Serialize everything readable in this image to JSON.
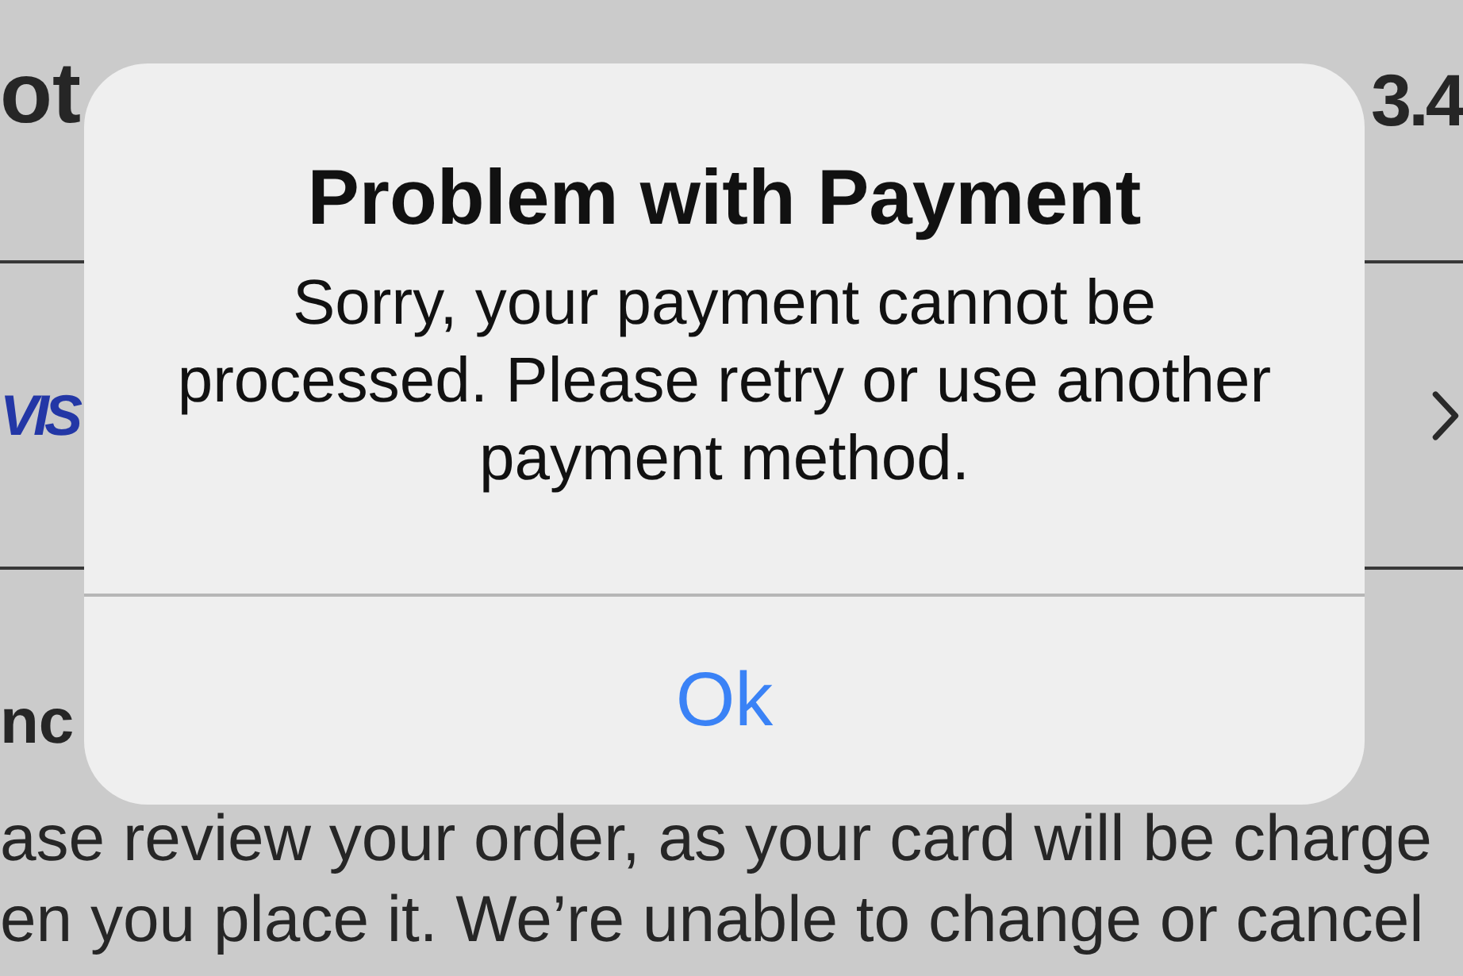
{
  "background_page": {
    "total_label": "ot",
    "total_amount": "3.4",
    "payment_card": {
      "logo_text": "VIS"
    },
    "section_heading": "nc",
    "notice_lines": [
      "ase review your order, as your card will be charge",
      "en you place it. We’re unable to change or cancel"
    ]
  },
  "alert": {
    "title": "Problem with Payment",
    "message": "Sorry, your payment cannot be processed. Please retry or use another payment method.",
    "buttons": [
      "Ok"
    ]
  }
}
